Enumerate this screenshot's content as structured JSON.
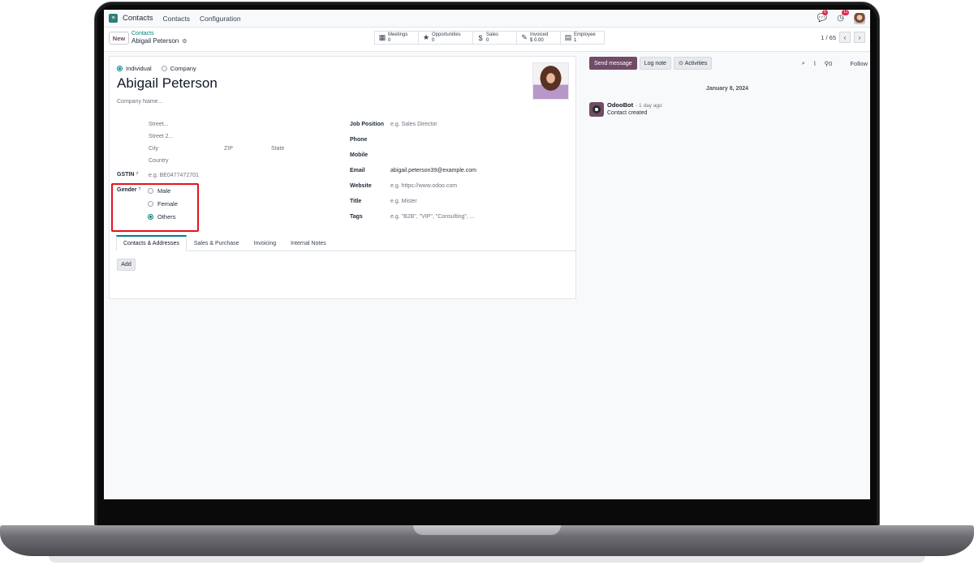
{
  "navbar": {
    "brand": "Contacts",
    "menu": [
      "Contacts",
      "Configuration"
    ],
    "chat_badge": "5",
    "activity_badge": "11"
  },
  "control": {
    "new_label": "New",
    "breadcrumb": "Contacts",
    "record_title": "Abigail Peterson",
    "pager": "1 / 65",
    "smart_buttons": [
      {
        "label": "Meetings",
        "value": "0",
        "icon": "calendar-icon"
      },
      {
        "label": "Opportunities",
        "value": "0",
        "icon": "star-icon"
      },
      {
        "label": "Sales",
        "value": "0",
        "icon": "dollar-icon"
      },
      {
        "label": "Invoiced",
        "value": "$ 0.00",
        "icon": "pencil-square-icon"
      },
      {
        "label": "Employee",
        "value": "1",
        "icon": "id-card-icon"
      }
    ]
  },
  "form": {
    "type_individual": "Individual",
    "type_company": "Company",
    "name": "Abigail Peterson",
    "company_placeholder": "Company Name...",
    "street_placeholder": "Street...",
    "street2_placeholder": "Street 2...",
    "city_placeholder": "City",
    "zip_placeholder": "ZIP",
    "state_placeholder": "State",
    "country_placeholder": "Country",
    "gstin_label": "GSTIN",
    "gstin_help": "?",
    "gstin_placeholder": "e.g. BE0477472701",
    "gender_label": "Gender",
    "gender_help": "?",
    "gender_options": [
      "Male",
      "Female",
      "Others"
    ],
    "gender_selected": "Others",
    "job_position_label": "Job Position",
    "job_position_placeholder": "e.g. Sales Director",
    "phone_label": "Phone",
    "mobile_label": "Mobile",
    "email_label": "Email",
    "email_value": "abigail.peterson39@example.com",
    "website_label": "Website",
    "website_placeholder": "e.g. https://www.odoo.com",
    "title_label": "Title",
    "title_placeholder": "e.g. Mister",
    "tags_label": "Tags",
    "tags_placeholder": "e.g. \"B2B\", \"VIP\", \"Consulting\", ..."
  },
  "notebook": {
    "tabs": [
      "Contacts & Addresses",
      "Sales & Purchase",
      "Invoicing",
      "Internal Notes"
    ],
    "add_label": "Add"
  },
  "chatter": {
    "send_message": "Send message",
    "log_note": "Log note",
    "activities": "Activities",
    "followers_count": "0",
    "follow": "Follow",
    "date": "January 8, 2024",
    "author": "OdooBot",
    "time": "- 1 day ago",
    "body": "Contact created"
  },
  "colors": {
    "brand": "#714B67",
    "accent": "#017e84",
    "highlight": "#e1141e"
  }
}
